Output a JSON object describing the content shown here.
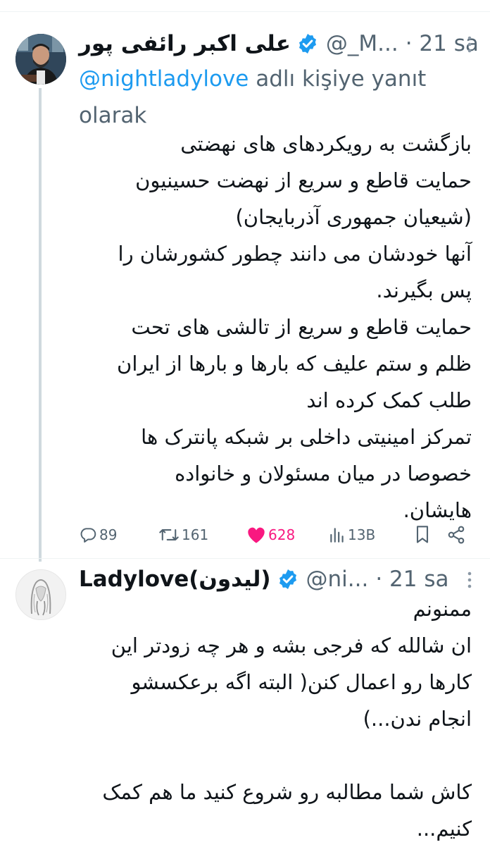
{
  "tweet1": {
    "display_name": "علی اکبر رائفی پور",
    "handle": "@_M...",
    "time": "· 21 sa",
    "reply_to": {
      "mention": "@nightladylove",
      "suffix": " adlı kişiye yanıt olarak"
    },
    "lines": [
      "بازگشت به رویکردهای های نهضتی",
      "حمایت قاطع و سریع از نهضت حسینیون",
      "(شیعیان جمهوری آذربایجان)",
      "آنها خودشان می دانند چطور کشورشان را",
      "پس بگیرند.",
      "حمایت قاطع و سریع از تالشی های تحت",
      "ظلم و ستم علیف که بارها و بارها از ایران",
      "طلب کمک کرده اند",
      "تمرکز امینیتی داخلی بر شبکه پانترک ها",
      "خصوصا در میان مسئولان و خانواده",
      "هایشان."
    ],
    "actions": {
      "replies": "89",
      "retweets": "161",
      "likes": "628",
      "views": "13B"
    },
    "icons": {
      "reply": "reply-icon",
      "retweet": "retweet-icon",
      "like": "heart-filled-icon",
      "views": "views-icon",
      "bookmark": "bookmark-icon",
      "share": "share-icon",
      "more": "more-icon",
      "verified": "verified-badge-icon"
    }
  },
  "tweet2": {
    "display_name": "Ladylove(لیدون)",
    "handle": "@ni...",
    "time": "· 21 sa",
    "lines": [
      "ممنونم",
      "ان شالله که فرجی بشه و هر چه زودتر این",
      "کارها رو اعمال کنن( البته اگه برعکسشو",
      "انجام ندن...)",
      "",
      "کاش شما مطالبه رو شروع کنید ما هم کمک",
      "کنیم..."
    ]
  },
  "colors": {
    "text": "#0f1419",
    "secondary": "#536471",
    "link": "#1d9bf0",
    "like": "#f91880",
    "verified": "#1d9bf0",
    "thread_line": "#cfd9de"
  }
}
